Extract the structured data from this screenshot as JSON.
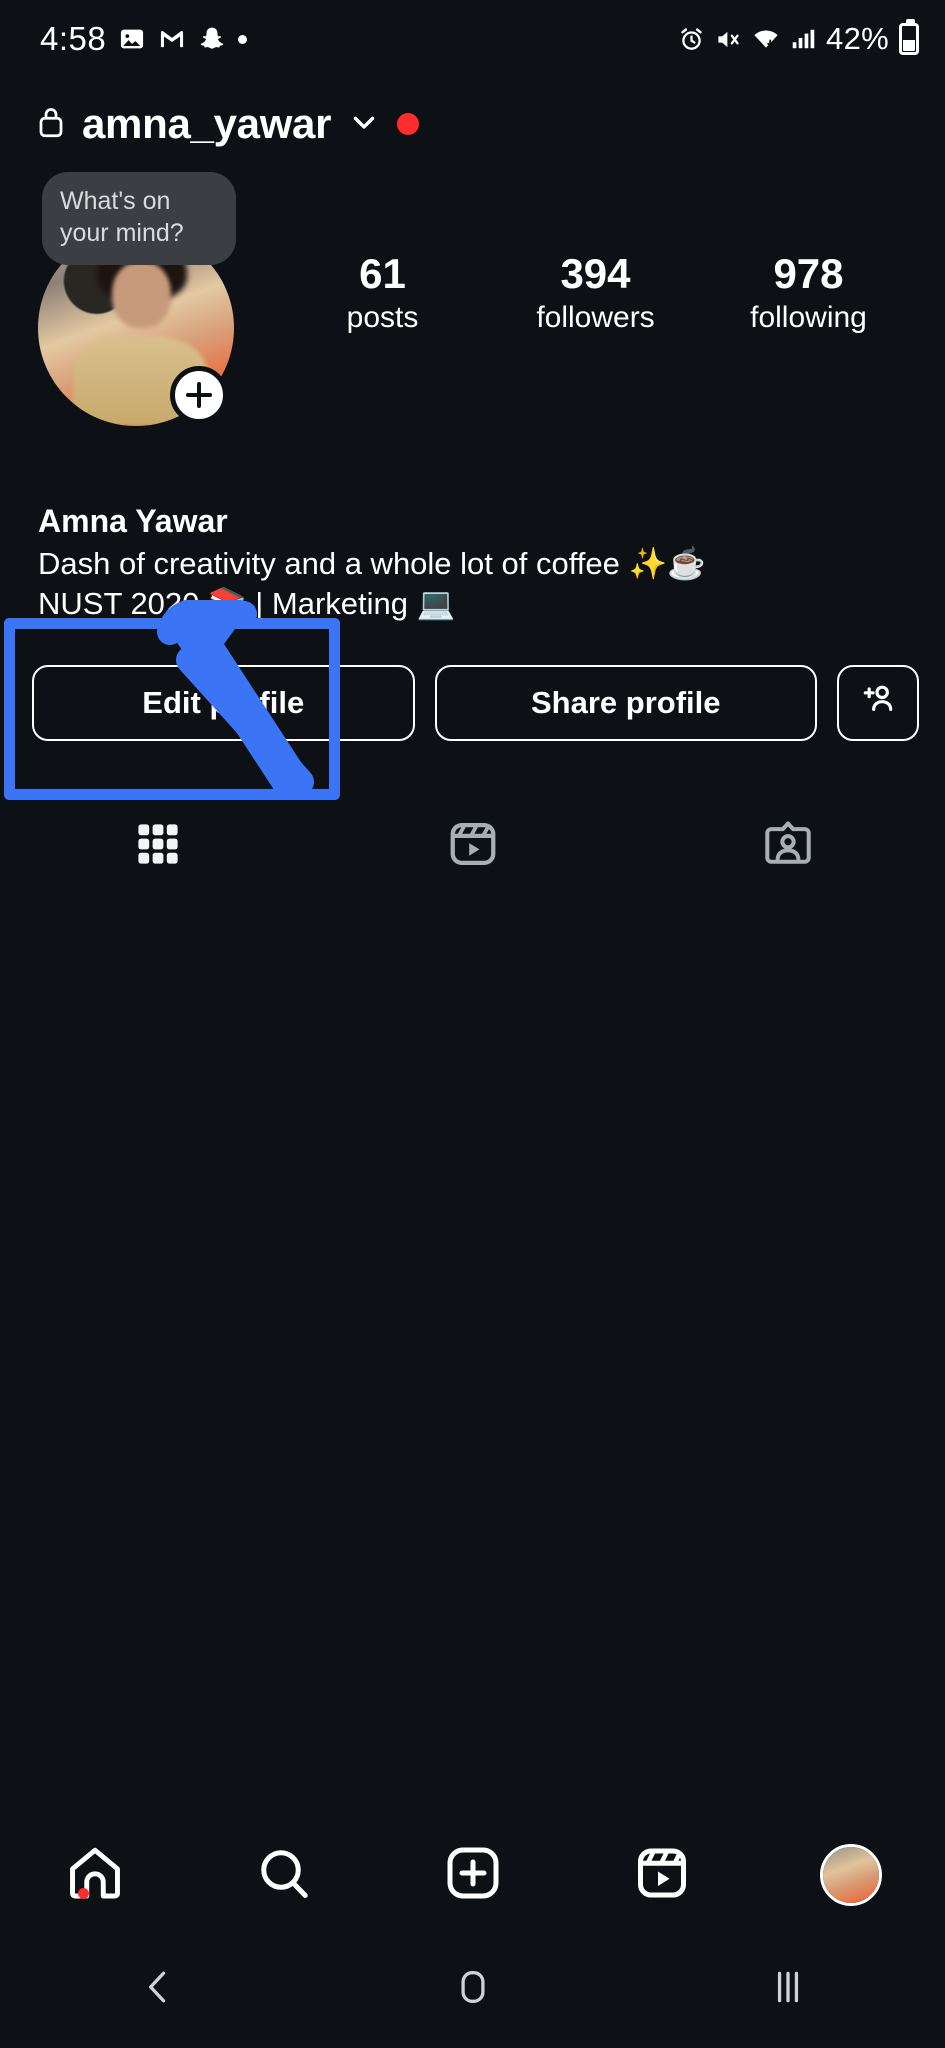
{
  "status_bar": {
    "time": "4:58",
    "left_icons": [
      "photos-icon",
      "gmail-icon",
      "snapchat-icon",
      "status-dot-icon"
    ],
    "right_icons": [
      "alarm-icon",
      "mute-icon",
      "wifi-icon",
      "signal-icon"
    ],
    "battery_percent": "42%",
    "battery_icon": "battery-icon"
  },
  "header": {
    "lock_icon": "lock-icon",
    "username": "amna_yawar",
    "chevron_icon": "chevron-down-icon",
    "badge_icon": "red-dot-badge"
  },
  "tooltip": {
    "text": "What's on your mind?"
  },
  "avatar": {
    "name": "profile-avatar",
    "add_story_icon": "plus-icon"
  },
  "stats": [
    {
      "value": "61",
      "label": "posts"
    },
    {
      "value": "394",
      "label": "followers"
    },
    {
      "value": "978",
      "label": "following"
    }
  ],
  "bio": {
    "name": "Amna Yawar",
    "line1": "Dash of creativity and a whole lot of coffee ✨☕",
    "line2": "NUST 2020 📚 | Marketing 💻"
  },
  "actions": {
    "edit_profile": "Edit profile",
    "share_profile": "Share profile",
    "add_person_icon": "add-person-icon"
  },
  "annotation": {
    "highlight_color": "#3b74f5",
    "arrow_color": "#3b74f5",
    "target": "edit-profile-button"
  },
  "content_tabs": [
    {
      "icon": "grid-icon",
      "active": true
    },
    {
      "icon": "reels-icon",
      "active": false
    },
    {
      "icon": "tagged-icon",
      "active": false
    }
  ],
  "bottom_nav": [
    {
      "icon": "home-icon",
      "badge": true
    },
    {
      "icon": "search-icon",
      "badge": false
    },
    {
      "icon": "create-icon",
      "badge": false
    },
    {
      "icon": "reels-icon",
      "badge": false
    },
    {
      "icon": "profile-avatar-icon",
      "badge": false
    }
  ],
  "system_nav": [
    {
      "icon": "back-icon"
    },
    {
      "icon": "home-square-icon"
    },
    {
      "icon": "recents-icon"
    }
  ],
  "colors": {
    "background": "#0d1115",
    "text": "#ffffff",
    "accent_blue": "#3b74f5",
    "badge_red": "#ff2d2d",
    "tooltip_bg": "#3b3e42",
    "inactive_tab": "#a8aeb5"
  }
}
